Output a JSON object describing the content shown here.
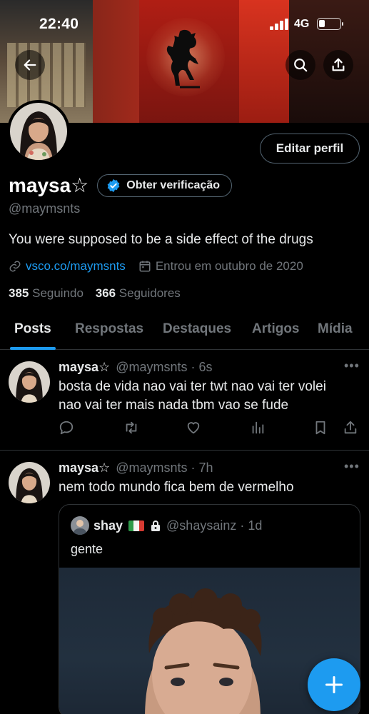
{
  "status_bar": {
    "time": "22:40",
    "network": "4G"
  },
  "profile": {
    "display_name": "maysa☆",
    "verify_label": "Obter verificação",
    "edit_label": "Editar perfil",
    "handle": "@maymsnts",
    "bio": "You were supposed to be a side effect of the drugs",
    "link": "vsco.co/maymsnts",
    "joined": "Entrou em outubro de 2020",
    "following_count": "385",
    "following_label": "Seguindo",
    "followers_count": "366",
    "followers_label": "Seguidores"
  },
  "tabs": [
    {
      "label": "Posts",
      "active": true
    },
    {
      "label": "Respostas"
    },
    {
      "label": "Destaques"
    },
    {
      "label": "Artigos"
    },
    {
      "label": "Mídia"
    }
  ],
  "tweets": [
    {
      "name": "maysa☆",
      "handle_time": "@maymsnts · 6s",
      "text_line1": "bosta de vida nao vai ter twt nao vai ter volei",
      "text_line2": "nao vai ter mais nada tbm vao se fude"
    },
    {
      "name": "maysa☆",
      "handle_time": "@maymsnts · 7h",
      "text": "nem todo mundo fica bem de vermelho",
      "quote": {
        "name": "shay",
        "handle_time": "@shaysainz · 1d",
        "text": "gente"
      }
    }
  ],
  "colors": {
    "accent": "#1d9bf0",
    "background": "#000000",
    "secondary_text": "#71767b"
  },
  "icons": [
    "back-arrow-icon",
    "search-icon",
    "share-icon",
    "verified-badge-icon",
    "link-icon",
    "calendar-icon",
    "reply-icon",
    "retweet-icon",
    "like-icon",
    "views-icon",
    "bookmark-icon",
    "more-icon",
    "lock-icon",
    "italy-flag-icon",
    "plus-icon"
  ]
}
